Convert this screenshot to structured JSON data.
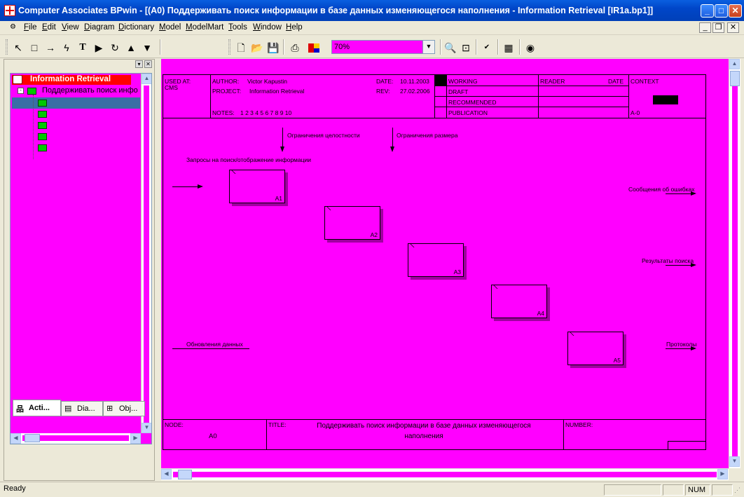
{
  "window": {
    "title": "Computer Associates BPwin - [(A0) Поддерживать поиск информации  в базе данных  изменяющегося наполнения - Information Retrieval  [IR1a.bp1]]",
    "min_label": "_",
    "max_label": "□",
    "close_label": "✕"
  },
  "menu": {
    "items": [
      "File",
      "Edit",
      "View",
      "Diagram",
      "Dictionary",
      "Model",
      "ModelMart",
      "Tools",
      "Window",
      "Help"
    ],
    "mdi_min": "_",
    "mdi_restore": "❐",
    "mdi_close": "✕"
  },
  "toolbar": {
    "pointer_icon": "pointer-icon",
    "zoom_value": "70%"
  },
  "explorer": {
    "root_label": "Information Retrieval",
    "child_label": "Поддерживать поиск инфо",
    "tabs": [
      "Acti...",
      "Dia...",
      "Obj..."
    ]
  },
  "diagram": {
    "header": {
      "used_at": "USED AT:",
      "used_at_value": "CMS",
      "author_label": "AUTHOR:",
      "author": "Victor Kapustin",
      "project_label": "PROJECT:",
      "project": "Information Retrieval",
      "date_label": "DATE:",
      "date": "10.11.2003",
      "rev_label": "REV:",
      "rev": "27.02.2006",
      "notes_label": "NOTES:",
      "notes": "1  2  3  4  5  6  7  8  9  10",
      "status": [
        "WORKING",
        "DRAFT",
        "RECOMMENDED",
        "PUBLICATION"
      ],
      "reader_label": "READER",
      "reader_date_label": "DATE",
      "context_label": "CONTEXT",
      "context_node": "A-0"
    },
    "arrows": {
      "control1": "Ограничения целостности",
      "control2": "Ограничения размера",
      "input1": "Запросы на поиск/отображение информации",
      "input2": "Обновления данных",
      "output1": "Сообщения об ошибках",
      "output2": "Результаты поиска",
      "output3": "Протоколы"
    },
    "activities": [
      "A1",
      "A2",
      "A3",
      "A4",
      "A5"
    ],
    "footer": {
      "node_label": "NODE:",
      "node": "A0",
      "title_label": "TITLE:",
      "title": "Поддерживать поиск информации  в базе данных  изменяющегося наполнения",
      "number_label": "NUMBER:"
    }
  },
  "status": {
    "ready": "Ready",
    "num": "NUM"
  },
  "colors": {
    "canvas": "#ff00ff",
    "root_highlight": "#ff0000",
    "titlebar": "#0046c8"
  }
}
